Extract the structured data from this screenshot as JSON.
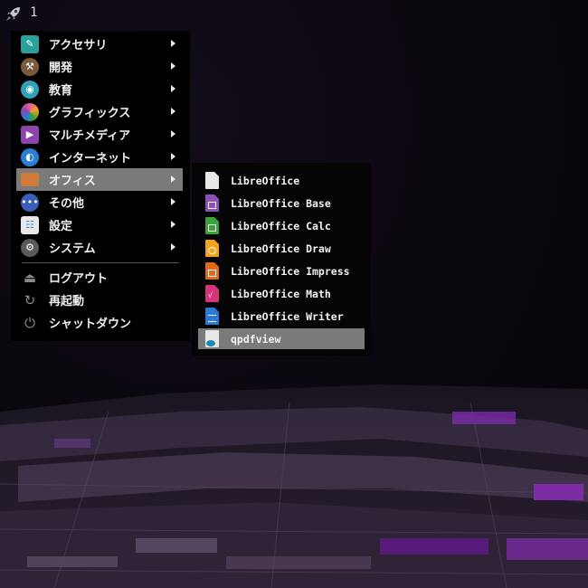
{
  "topbar": {
    "launcher_icon": "rocket-icon",
    "workspace": "1"
  },
  "menu": {
    "categories": [
      {
        "label": "アクセサリ",
        "icon": "accessories-icon",
        "color": "#2aa198"
      },
      {
        "label": "開発",
        "icon": "hammer-icon",
        "color": "#7a5a3a"
      },
      {
        "label": "教育",
        "icon": "education-icon",
        "color": "#2fa3b5"
      },
      {
        "label": "グラフィックス",
        "icon": "graphics-icon",
        "color": "#e85d9a"
      },
      {
        "label": "マルチメディア",
        "icon": "multimedia-icon",
        "color": "#8e44ad"
      },
      {
        "label": "インターネット",
        "icon": "internet-icon",
        "color": "#2a7fd4"
      },
      {
        "label": "オフィス",
        "icon": "office-icon",
        "color": "#d07a3a"
      },
      {
        "label": "その他",
        "icon": "other-icon",
        "color": "#3a5fb8"
      },
      {
        "label": "設定",
        "icon": "settings-icon",
        "color": "#4a8ab8"
      },
      {
        "label": "システム",
        "icon": "system-icon",
        "color": "#6a6a6a"
      }
    ],
    "actions": [
      {
        "label": "ログアウト",
        "icon": "logout-icon"
      },
      {
        "label": "再起動",
        "icon": "reboot-icon"
      },
      {
        "label": "シャットダウン",
        "icon": "shutdown-icon"
      }
    ],
    "active_index": 6
  },
  "submenu": {
    "items": [
      {
        "label": "LibreOffice",
        "icon": "libreoffice-icon",
        "color": "#e8e8e8"
      },
      {
        "label": "LibreOffice Base",
        "icon": "libreoffice-base-icon",
        "color": "#8e4fb8"
      },
      {
        "label": "LibreOffice Calc",
        "icon": "libreoffice-calc-icon",
        "color": "#3aa33a"
      },
      {
        "label": "LibreOffice Draw",
        "icon": "libreoffice-draw-icon",
        "color": "#f2a21c"
      },
      {
        "label": "LibreOffice Impress",
        "icon": "libreoffice-impress-icon",
        "color": "#e06a1c"
      },
      {
        "label": "LibreOffice Math",
        "icon": "libreoffice-math-icon",
        "color": "#d8327a"
      },
      {
        "label": "LibreOffice Writer",
        "icon": "libreoffice-writer-icon",
        "color": "#2a7ad8"
      },
      {
        "label": "qpdfview",
        "icon": "qpdfview-icon",
        "color": "#e8e8e8"
      }
    ],
    "active_index": 7
  }
}
